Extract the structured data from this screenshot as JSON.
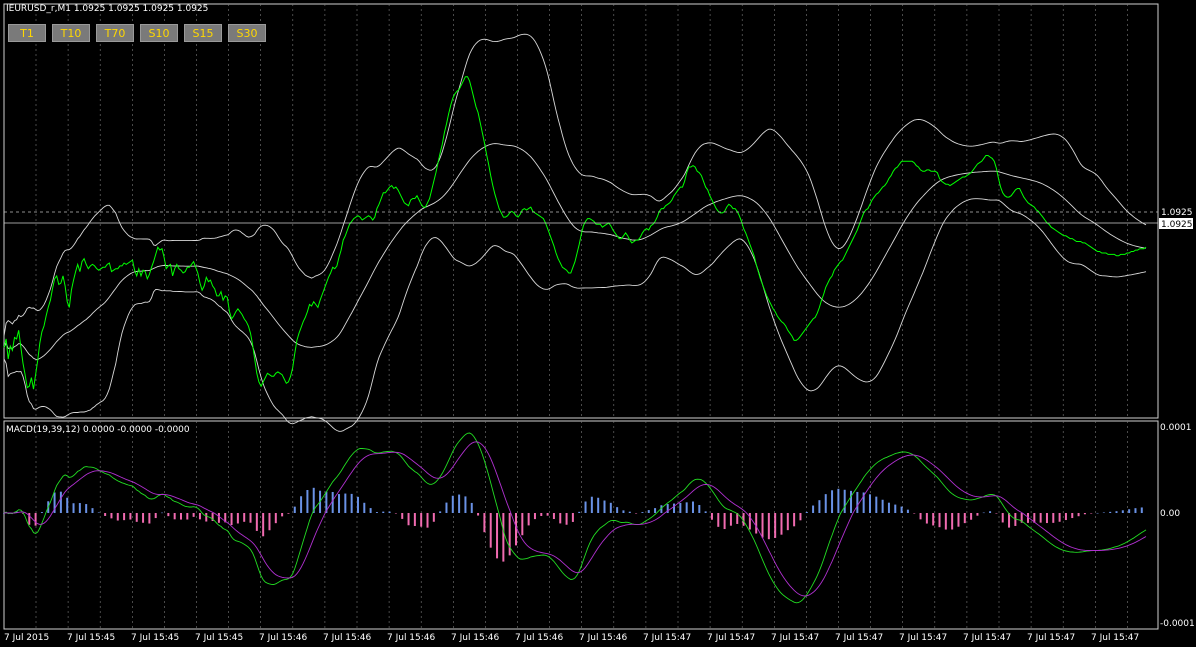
{
  "header": {
    "symbol_line": "IEURUSD_r,M1  1.0925 1.0925 1.0925 1.0925",
    "timeframe_buttons": [
      "T1",
      "T10",
      "T70",
      "S10",
      "S15",
      "S30"
    ]
  },
  "macd_header": "MACD(19,39,12) 0.0000 -0.0000 -0.0000",
  "colors": {
    "price": "#00ff00",
    "bands": "#d8d8d8",
    "macd_line": "#22dd22",
    "signal_line": "#b030d0",
    "hist_pos": "#6a92e6",
    "hist_neg": "#f06bb0",
    "grid": "#7a7a7a"
  },
  "chart_data": [
    {
      "type": "line",
      "name": "price-panel",
      "current_price_label": "1.0925",
      "bid_price_label": "1.0925",
      "x_tick_labels": [
        "7 Jul 2015",
        "7 Jul 15:45",
        "7 Jul 15:45",
        "7 Jul 15:45",
        "7 Jul 15:46",
        "7 Jul 15:46",
        "7 Jul 15:46",
        "7 Jul 15:46",
        "7 Jul 15:46",
        "7 Jul 15:46",
        "7 Jul 15:47",
        "7 Jul 15:47",
        "7 Jul 15:47",
        "7 Jul 15:47",
        "7 Jul 15:47",
        "7 Jul 15:47",
        "7 Jul 15:47",
        "7 Jul 15:47"
      ],
      "price_y": [
        0.3,
        0.36,
        0.22,
        0.31,
        0.28,
        0.37,
        0.36,
        0.42,
        0.3,
        0.19,
        0.11,
        0.02,
        0.03,
        0.09,
        0.01,
        0.11,
        0.21,
        0.33,
        0.41,
        0.45,
        0.52,
        0.58,
        0.63,
        0.71,
        0.78,
        0.8,
        0.74,
        0.75,
        0.8,
        0.73,
        0.62,
        0.58,
        0.7,
        0.77,
        0.83,
        0.88,
        0.83,
        0.9,
        0.92,
        0.88,
        0.85,
        0.87,
        0.88,
        0.87,
        0.85,
        0.84,
        0.85,
        0.86,
        0.86,
        0.88,
        0.89,
        0.83,
        0.84,
        0.85,
        0.85,
        0.87,
        0.87,
        0.89,
        0.88,
        0.89,
        0.9,
        0.91,
        0.84,
        0.8,
        0.85,
        0.8,
        0.84,
        0.83,
        0.78,
        0.81,
        0.86,
        0.9,
        0.95,
        1.0,
        0.98,
        0.99,
        0.93,
        0.85,
        0.87,
        0.88,
        0.8,
        0.85,
        0.88,
        0.85,
        0.84,
        0.82,
        0.83,
        0.86,
        0.86,
        0.88,
        0.9,
        0.86,
        0.82,
        0.75,
        0.7,
        0.73,
        0.79,
        0.76,
        0.77,
        0.73,
        0.71,
        0.66,
        0.66,
        0.69,
        0.63,
        0.66,
        0.65,
        0.55,
        0.5,
        0.52,
        0.55,
        0.57,
        0.55,
        0.53,
        0.5,
        0.48,
        0.45,
        0.4,
        0.32,
        0.22,
        0.12,
        0.06,
        0.03,
        0.06,
        0.09,
        0.12,
        0.11,
        0.1,
        0.1,
        0.12,
        0.13,
        0.12,
        0.11,
        0.08,
        0.05,
        0.06,
        0.1,
        0.16,
        0.26,
        0.35,
        0.4,
        0.44,
        0.48,
        0.51,
        0.55,
        0.6,
        0.59,
        0.62,
        0.6,
        0.58,
        0.63,
        0.67,
        0.71,
        0.75,
        0.79,
        0.82,
        0.86,
        0.85,
        0.87,
        0.93,
        0.98,
        1.05,
        1.08,
        1.12,
        1.16,
        1.18,
        1.2,
        1.21,
        1.22,
        1.21,
        1.19,
        1.2,
        1.21,
        1.22,
        1.21,
        1.19,
        1.21,
        1.27,
        1.3,
        1.34,
        1.38,
        1.38,
        1.4,
        1.42,
        1.43,
        1.41,
        1.42,
        1.4,
        1.37,
        1.34,
        1.31,
        1.3,
        1.29,
        1.33,
        1.34,
        1.34,
        1.36,
        1.33,
        1.3,
        1.28,
        1.28,
        1.31,
        1.34,
        1.4,
        1.46,
        1.52,
        1.59,
        1.66,
        1.72,
        1.8,
        1.86,
        1.93,
        1.99,
        2.04,
        2.07,
        2.09,
        2.1,
        2.13,
        2.16,
        2.19,
        2.19,
        2.16,
        2.1,
        2.04,
        1.98,
        1.94,
        1.87,
        1.8,
        1.73,
        1.65,
        1.58,
        1.5,
        1.43,
        1.37,
        1.32,
        1.27,
        1.24,
        1.21,
        1.21,
        1.22,
        1.24,
        1.25,
        1.24,
        1.22,
        1.21,
        1.23,
        1.26,
        1.27,
        1.26,
        1.27,
        1.28,
        1.25,
        1.24,
        1.23,
        1.22,
        1.21,
        1.2,
        1.17,
        1.13,
        1.09,
        1.05,
        1.01,
        0.96,
        0.92,
        0.89,
        0.86,
        0.85,
        0.84,
        0.82,
        0.82,
        0.86,
        0.9,
        0.96,
        1.02,
        1.09,
        1.15,
        1.18,
        1.2,
        1.2,
        1.19,
        1.18,
        1.16,
        1.16,
        1.16,
        1.14,
        1.15,
        1.16,
        1.17,
        1.15,
        1.12,
        1.1,
        1.08,
        1.06,
        1.06,
        1.08,
        1.1,
        1.08,
        1.05,
        1.03,
        1.04,
        1.05,
        1.05,
        1.07,
        1.1,
        1.12,
        1.13,
        1.12,
        1.15,
        1.16,
        1.18,
        1.21,
        1.25,
        1.27,
        1.27,
        1.29,
        1.3,
        1.31,
        1.33,
        1.36,
        1.38,
        1.4,
        1.42,
        1.42,
        1.46,
        1.52,
        1.56,
        1.56,
        1.57,
        1.56,
        1.53,
        1.52,
        1.5,
        1.46,
        1.42,
        1.4,
        1.36,
        1.33,
        1.3,
        1.27,
        1.25,
        1.24,
        1.24,
        1.25,
        1.28,
        1.3,
        1.29,
        1.27,
        1.27,
        1.25,
        1.22,
        1.18,
        1.13,
        1.1,
        1.06,
        1.02,
        0.98,
        0.94,
        0.88,
        0.83,
        0.78,
        0.74,
        0.7,
        0.66,
        0.63,
        0.6,
        0.57,
        0.55,
        0.52,
        0.5,
        0.48,
        0.47,
        0.45,
        0.42,
        0.4,
        0.38,
        0.35,
        0.35,
        0.36,
        0.38,
        0.4,
        0.42,
        0.44,
        0.46,
        0.48,
        0.5,
        0.51,
        0.54,
        0.58,
        0.63,
        0.67,
        0.72,
        0.75,
        0.78,
        0.8,
        0.84,
        0.86,
        0.88,
        0.9,
        0.91,
        0.94,
        0.97,
        1.0,
        1.03,
        1.06,
        1.09,
        1.12,
        1.16,
        1.2,
        1.24,
        1.26,
        1.27,
        1.3,
        1.33,
        1.35,
        1.37,
        1.38,
        1.4,
        1.42,
        1.43,
        1.45,
        1.48,
        1.5,
        1.53,
        1.55,
        1.56,
        1.58,
        1.6,
        1.6,
        1.6,
        1.6,
        1.6,
        1.6,
        1.59,
        1.57,
        1.56,
        1.54,
        1.53,
        1.53,
        1.54,
        1.54,
        1.53,
        1.53,
        1.53,
        1.52,
        1.48,
        1.46,
        1.45,
        1.44,
        1.44,
        1.43,
        1.44,
        1.45,
        1.46,
        1.47,
        1.48,
        1.49,
        1.49,
        1.5,
        1.51,
        1.52,
        1.54,
        1.56,
        1.58,
        1.59,
        1.6,
        1.62,
        1.64,
        1.64,
        1.63,
        1.62,
        1.6,
        1.55,
        1.48,
        1.42,
        1.38,
        1.36,
        1.35,
        1.35,
        1.36,
        1.38,
        1.4,
        1.41,
        1.41,
        1.38,
        1.35,
        1.33,
        1.31,
        1.3,
        1.29,
        1.28,
        1.26,
        1.25,
        1.23,
        1.21,
        1.19,
        1.17,
        1.16,
        1.14,
        1.13,
        1.12,
        1.11,
        1.1,
        1.09,
        1.08,
        1.08,
        1.07,
        1.06,
        1.06,
        1.05,
        1.04,
        1.04,
        1.04,
        1.03,
        1.03,
        1.02,
        1.01,
        1.0,
        0.99,
        0.98,
        0.97,
        0.97,
        0.96,
        0.96,
        0.96,
        0.95,
        0.95,
        0.95,
        0.95,
        0.94,
        0.94,
        0.95,
        0.95,
        0.95,
        0.96,
        0.96,
        0.97,
        0.97,
        0.98,
        0.98,
        0.99,
        0.99,
        0.99,
        1.0
      ]
    },
    {
      "type": "bar",
      "name": "macd-panel",
      "ylabels": [
        "0.0001",
        "0.00",
        "-0.0001"
      ]
    }
  ]
}
